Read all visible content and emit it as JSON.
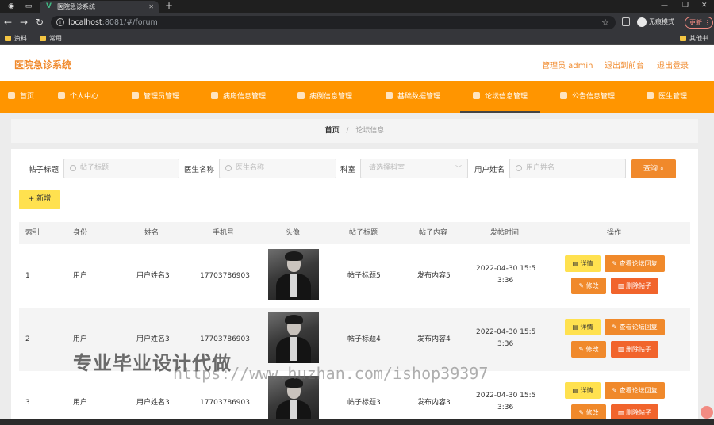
{
  "browser": {
    "tab_title": "医院急诊系统",
    "url_host": "localhost",
    "url_path": ":8081/#/forum",
    "profile_label": "无痕模式",
    "update_label": "更新",
    "bookmarks": [
      "资料",
      "常用"
    ],
    "other_bookmarks": "其他书签"
  },
  "header": {
    "title": "医院急诊系统",
    "admin_label": "管理员 admin",
    "front_link": "退出到前台",
    "logout_link": "退出登录"
  },
  "menu": [
    {
      "label": "首页"
    },
    {
      "label": "个人中心"
    },
    {
      "label": "管理员管理"
    },
    {
      "label": "病房信息管理"
    },
    {
      "label": "病例信息管理"
    },
    {
      "label": "基础数据管理"
    },
    {
      "label": "论坛信息管理"
    },
    {
      "label": "公告信息管理"
    },
    {
      "label": "医生管理"
    }
  ],
  "breadcrumb": {
    "home": "首页",
    "sep": "/",
    "current": "论坛信息"
  },
  "filters": {
    "post_title_label": "帖子标题",
    "post_title_placeholder": "帖子标题",
    "doctor_label": "医生名称",
    "doctor_placeholder": "医生名称",
    "dept_label": "科室",
    "dept_placeholder": "请选择科室",
    "user_label": "用户姓名",
    "user_placeholder": "用户姓名",
    "query_label": "查询",
    "add_label": "新增"
  },
  "table": {
    "columns": [
      "索引",
      "身份",
      "姓名",
      "手机号",
      "头像",
      "帖子标题",
      "帖子内容",
      "发帖时间",
      "操作"
    ],
    "rows": [
      {
        "index": "1",
        "role": "用户",
        "name": "用户姓名3",
        "phone": "17703786903",
        "title": "帖子标题5",
        "content": "发布内容5",
        "time1": "2022-04-30 15:5",
        "time2": "3:36"
      },
      {
        "index": "2",
        "role": "用户",
        "name": "用户姓名3",
        "phone": "17703786903",
        "title": "帖子标题4",
        "content": "发布内容4",
        "time1": "2022-04-30 15:5",
        "time2": "3:36"
      },
      {
        "index": "3",
        "role": "用户",
        "name": "用户姓名3",
        "phone": "17703786903",
        "title": "帖子标题3",
        "content": "发布内容3",
        "time1": "2022-04-30 15:5",
        "time2": "3:36"
      }
    ],
    "actions": {
      "detail": "详情",
      "view_replies": "查看论坛回复",
      "edit": "修改",
      "delete": "删除帖子"
    }
  },
  "watermark": {
    "text_cn": "专业毕业设计代做",
    "text_url": "https://www.huzhan.com/ishop39397"
  },
  "colors": {
    "accent": "#ff9500",
    "accent_text": "#f0892b",
    "button_yellow": "#ffe14f",
    "button_red": "#f1642c"
  }
}
